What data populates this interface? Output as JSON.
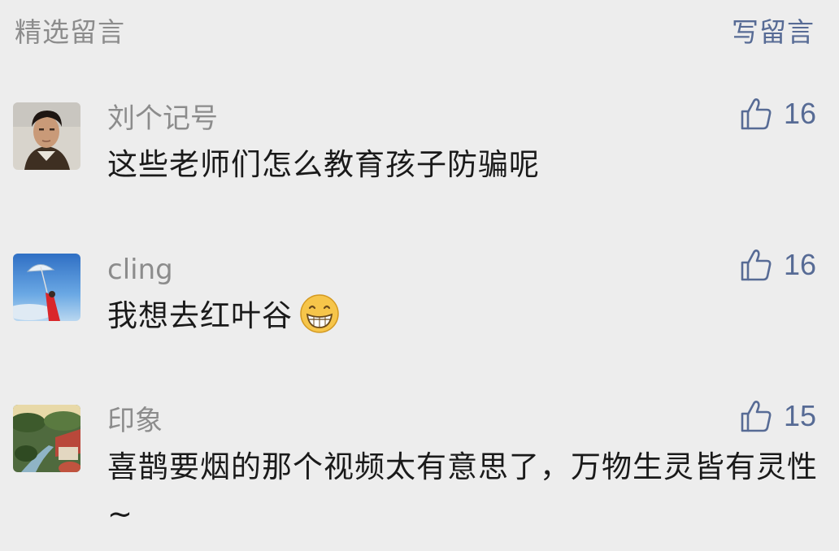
{
  "header": {
    "title": "精选留言",
    "write_label": "写留言"
  },
  "comments": [
    {
      "nickname": "刘个记号",
      "content": "这些老师们怎么教育孩子防骗呢",
      "likes": "16"
    },
    {
      "nickname": "cling",
      "content": "我想去红叶谷",
      "emoji": "grin-emoji",
      "likes": "16"
    },
    {
      "nickname": "印象",
      "content": "喜鹊要烟的那个视频太有意思了，万物生灵皆有灵性~",
      "likes": "15"
    }
  ],
  "colors": {
    "background": "#ededed",
    "link": "#576b95",
    "muted": "#8c8c8c",
    "text": "#1a1a1a"
  }
}
